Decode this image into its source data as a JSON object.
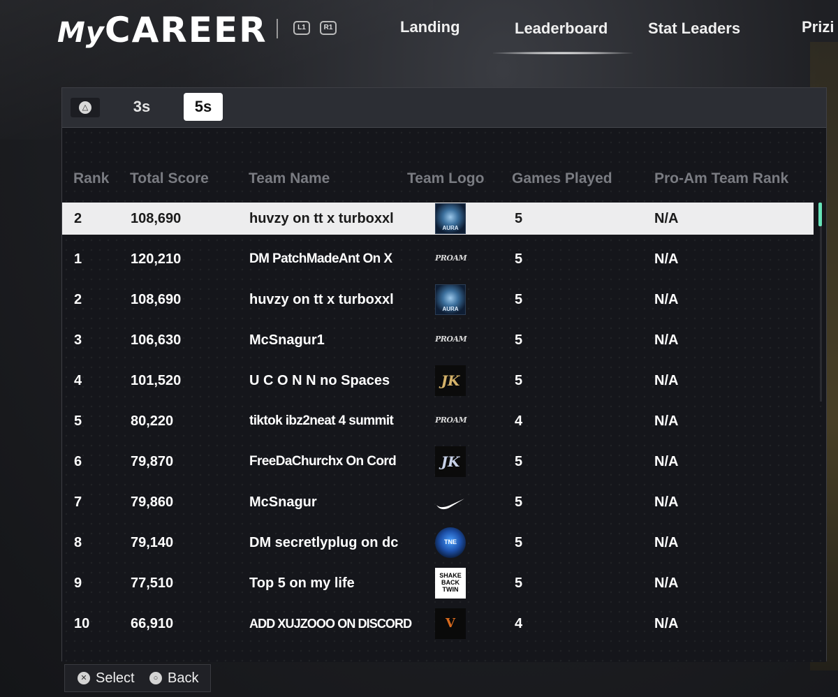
{
  "header": {
    "logo_my": "My",
    "logo_career": "CAREER",
    "bumper_left": "L1",
    "bumper_right": "R1",
    "nav": [
      {
        "label": "Landing"
      },
      {
        "label": "Leaderboard"
      },
      {
        "label": "Stat Leaders"
      },
      {
        "label": "Prizi"
      }
    ]
  },
  "tabs": {
    "triangle_glyph": "△",
    "items": [
      {
        "label": "3s"
      },
      {
        "label": "5s"
      }
    ],
    "selected": "5s"
  },
  "table": {
    "columns": [
      "Rank",
      "Total Score",
      "Team Name",
      "Team Logo",
      "Games Played",
      "Pro-Am Team Rank"
    ],
    "selected_row": {
      "rank": "2",
      "score": "108,690",
      "team": "huvzy on tt  x turboxxl",
      "logo": "aura-logo",
      "logo_text": "AURA",
      "games": "5",
      "proam_rank": "N/A"
    },
    "rows": [
      {
        "rank": "1",
        "score": "120,210",
        "team": "DM PatchMadeAnt On X",
        "logo": "proam-logo",
        "logo_text": "PROAM",
        "games": "5",
        "proam_rank": "N/A"
      },
      {
        "rank": "2",
        "score": "108,690",
        "team": "huvzy on tt  x turboxxl",
        "logo": "aura-logo",
        "logo_text": "AURA",
        "games": "5",
        "proam_rank": "N/A"
      },
      {
        "rank": "3",
        "score": "106,630",
        "team": "McSnagur1",
        "logo": "proam-logo",
        "logo_text": "PROAM",
        "games": "5",
        "proam_rank": "N/A"
      },
      {
        "rank": "4",
        "score": "101,520",
        "team": "U C O N N no Spaces",
        "logo": "jk-logo",
        "logo_text": "JK",
        "games": "5",
        "proam_rank": "N/A"
      },
      {
        "rank": "5",
        "score": "80,220",
        "team": "tiktok ibz2neat 4 summit",
        "logo": "proam-logo",
        "logo_text": "PROAM",
        "games": "4",
        "proam_rank": "N/A"
      },
      {
        "rank": "6",
        "score": "79,870",
        "team": "FreeDaChurchx On Cord",
        "logo": "jk-logo",
        "logo_text": "JK",
        "games": "5",
        "proam_rank": "N/A"
      },
      {
        "rank": "7",
        "score": "79,860",
        "team": "McSnagur",
        "logo": "nike-logo",
        "logo_text": "",
        "games": "5",
        "proam_rank": "N/A"
      },
      {
        "rank": "8",
        "score": "79,140",
        "team": "DM secretlyplug on dc",
        "logo": "tne-logo",
        "logo_text": "TNE",
        "games": "5",
        "proam_rank": "N/A"
      },
      {
        "rank": "9",
        "score": "77,510",
        "team": "Top 5 on my life",
        "logo": "shake-back-twin-logo",
        "logo_text": "SHAKE BACK TWIN",
        "games": "5",
        "proam_rank": "N/A"
      },
      {
        "rank": "10",
        "score": "66,910",
        "team": "ADD XUJZOOO ON DISCORD",
        "logo": "v-logo",
        "logo_text": "V",
        "games": "4",
        "proam_rank": "N/A"
      }
    ]
  },
  "footer": {
    "select_label": "Select",
    "back_label": "Back"
  },
  "colors": {
    "accent_scroll": "#67e3b8",
    "selected_row_bg": "#ededee",
    "header_text": "#7a7c82"
  }
}
